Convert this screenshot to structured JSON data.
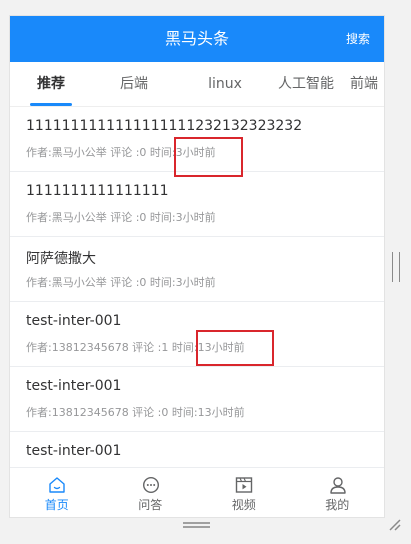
{
  "navbar": {
    "title": "黑马头条",
    "search_label": "搜索",
    "color": "#1989fa"
  },
  "tabs": [
    {
      "label": "推荐",
      "active": true
    },
    {
      "label": "后端",
      "active": false
    },
    {
      "label": "linux",
      "active": false
    },
    {
      "label": "人工智能",
      "active": false
    },
    {
      "label": "前端",
      "active": false
    }
  ],
  "articles": [
    {
      "title": "1111111111111111111232132323232",
      "meta": "作者:黑马小公举 评论 :0 时间:3小时前"
    },
    {
      "title": "1111111111111111",
      "meta": "作者:黑马小公举 评论 :0 时间:3小时前"
    },
    {
      "title": "阿萨德撒大",
      "meta": "作者:黑马小公举 评论 :0 时间:3小时前"
    },
    {
      "title": "test-inter-001",
      "meta": "作者:13812345678 评论 :1 时间:13小时前"
    },
    {
      "title": "test-inter-001",
      "meta": "作者:13812345678 评论 :0 时间:13小时前"
    },
    {
      "title": "test-inter-001",
      "meta": ""
    }
  ],
  "tabbar": [
    {
      "label": "首页",
      "icon": "home-icon",
      "active": true
    },
    {
      "label": "问答",
      "icon": "chat-icon",
      "active": false
    },
    {
      "label": "视频",
      "icon": "video-icon",
      "active": false
    },
    {
      "label": "我的",
      "icon": "user-icon",
      "active": false
    }
  ],
  "annotation_color": "#d9262c"
}
